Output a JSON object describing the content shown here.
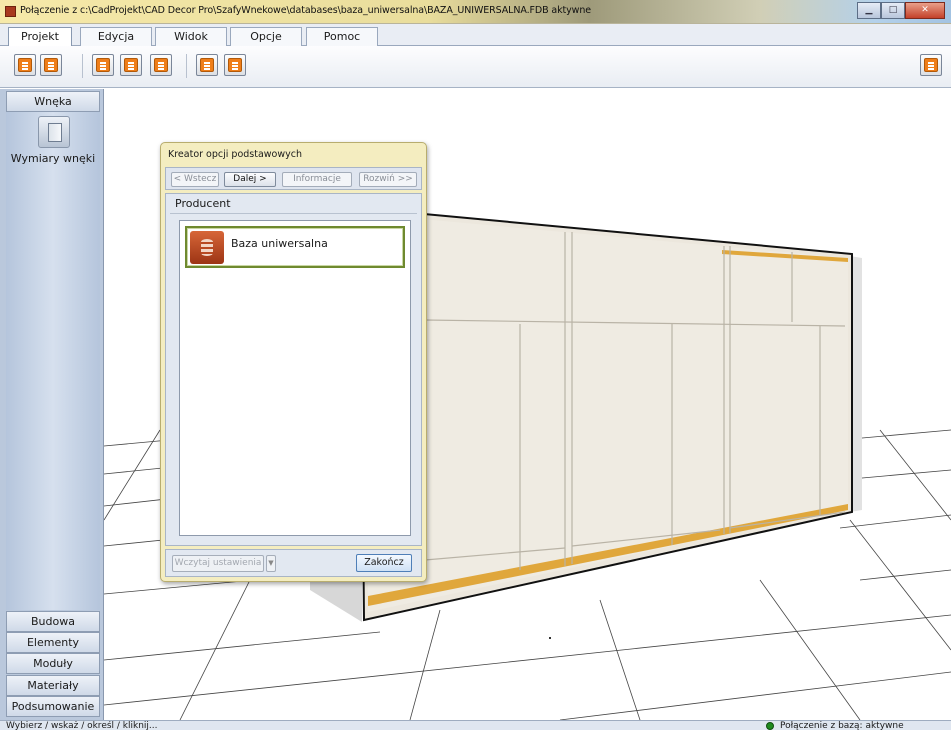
{
  "window": {
    "title": "Połączenie z c:\\CadProjekt\\CAD Decor Pro\\SzafyWnekowe\\databases\\baza_uniwersalna\\BAZA_UNIWERSALNA.FDB aktywne",
    "minimize_icon": "minimize-icon",
    "maximize_icon": "maximize-icon",
    "close_icon": "close-icon"
  },
  "menu_tabs": [
    {
      "label": "Projekt",
      "active": true
    },
    {
      "label": "Edycja"
    },
    {
      "label": "Widok"
    },
    {
      "label": "Opcje"
    },
    {
      "label": "Pomoc"
    }
  ],
  "toolbar": {
    "icons": [
      "database-icon",
      "contact-card-icon",
      "new-document-icon",
      "save-icon",
      "open-folder-icon",
      "import-icon",
      "export-icon"
    ],
    "right_icon": "calculator-icon",
    "accent_color": "#ef7e19"
  },
  "sidebar": {
    "header": "Wnęka",
    "item_icon": "niche-dimensions-icon",
    "item_label": "Wymiary wnęki",
    "bottom_buttons": [
      "Budowa",
      "Elementy",
      "Moduły",
      "Materiały",
      "Podsumowanie"
    ]
  },
  "dialog": {
    "title": "Kreator opcji podstawowych",
    "nav": {
      "back": "< Wstecz",
      "next": "Dalej >",
      "info": "Informacje",
      "expand": "Rozwiń >>"
    },
    "section_label": "Producent",
    "producers": [
      {
        "name": "Baza uniwersalna",
        "icon": "database-icon",
        "selected": true
      }
    ],
    "load_settings": "Wczytaj ustawienia",
    "finish": "Zakończ"
  },
  "status": {
    "left": "Wybierz / wskaż / określ / kliknij...",
    "right": "Połączenie z bazą: aktywne",
    "indicator_color": "#1e8a1e"
  }
}
